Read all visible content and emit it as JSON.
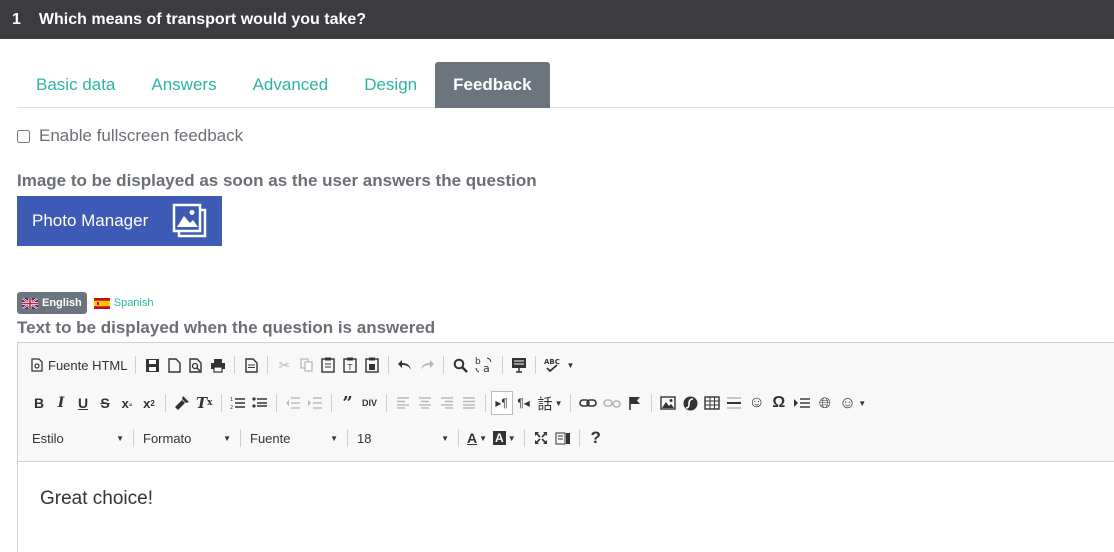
{
  "question": {
    "number": "1",
    "title": "Which means of transport would you take?"
  },
  "tabs": [
    {
      "label": "Basic data"
    },
    {
      "label": "Answers"
    },
    {
      "label": "Advanced"
    },
    {
      "label": "Design"
    },
    {
      "label": "Feedback",
      "active": true
    }
  ],
  "fullscreen": {
    "label": "Enable fullscreen feedback",
    "checked": false
  },
  "image_section": {
    "label": "Image to be displayed as soon as the user answers the question",
    "button_label": "Photo Manager"
  },
  "languages": [
    {
      "label": "English",
      "active": true
    },
    {
      "label": "Spanish",
      "active": false
    }
  ],
  "text_section": {
    "label": "Text to be displayed when the question is answered"
  },
  "editor": {
    "source_label": "Fuente HTML",
    "combos": {
      "style": "Estilo",
      "format": "Formato",
      "font": "Fuente",
      "size": "18"
    },
    "content": "Great choice!"
  },
  "colors": {
    "topbar": "#3b3b40",
    "tab_text": "#2bb5a2",
    "tab_active": "#6c757d",
    "photo_button": "#3d5bb5"
  }
}
